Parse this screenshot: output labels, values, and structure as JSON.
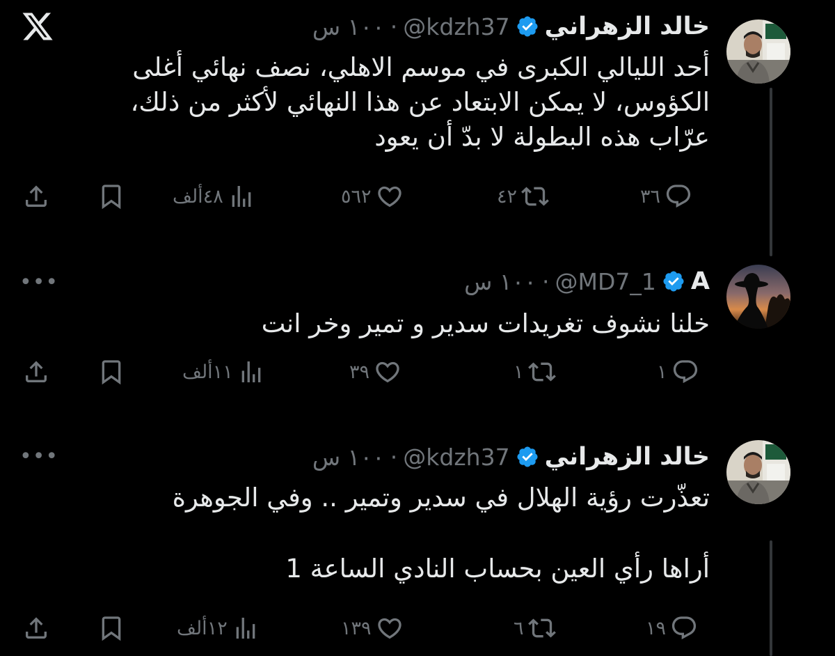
{
  "tweets": [
    {
      "display_name": "خالد الزهراني",
      "handle": "@kdzh37",
      "separator": "·",
      "time": "١٠٠ س",
      "avatar": "profile-photo-man",
      "lines": [
        "أحد الليالي الكبرى في موسم الاهلي، نصف نهائي أغلى",
        "الكؤوس، لا يمكن الابتعاد عن هذا النهائي لأكثر من ذلك،",
        "عرّاب هذه البطولة لا بدّ أن يعود"
      ],
      "replies": "٣٦",
      "retweets": "٤٢",
      "likes": "٥٦٢",
      "views": "٤٨ألف",
      "corner_icon": "x-logo-icon"
    },
    {
      "display_name": "A",
      "handle": "@MD7_1",
      "separator": "·",
      "time": "١٠٠ س",
      "avatar": "silhouette-sunset",
      "lines": [
        "خلنا نشوف تغريدات سدير و تمير وخر انت"
      ],
      "replies": "١",
      "retweets": "١",
      "likes": "٣٩",
      "views": "١١ألف",
      "corner_icon": "more-icon"
    },
    {
      "display_name": "خالد الزهراني",
      "handle": "@kdzh37",
      "separator": "·",
      "time": "١٠٠ س",
      "avatar": "profile-photo-man",
      "lines": [
        "تعذّرت رؤية الهلال في سدير وتمير .. وفي الجوهرة",
        "",
        "أراها رأي العين بحساب النادي الساعة 1"
      ],
      "replies": "١٩",
      "retweets": "٦",
      "likes": "١٣٩",
      "views": "١٢ألف",
      "corner_icon": "more-icon"
    }
  ],
  "colors": {
    "background": "#000000",
    "text": "#e7e9ea",
    "muted": "#71767b",
    "verified": "#1d9bf0",
    "thread_line": "#333639"
  },
  "ui": {
    "more_label": "•••"
  }
}
